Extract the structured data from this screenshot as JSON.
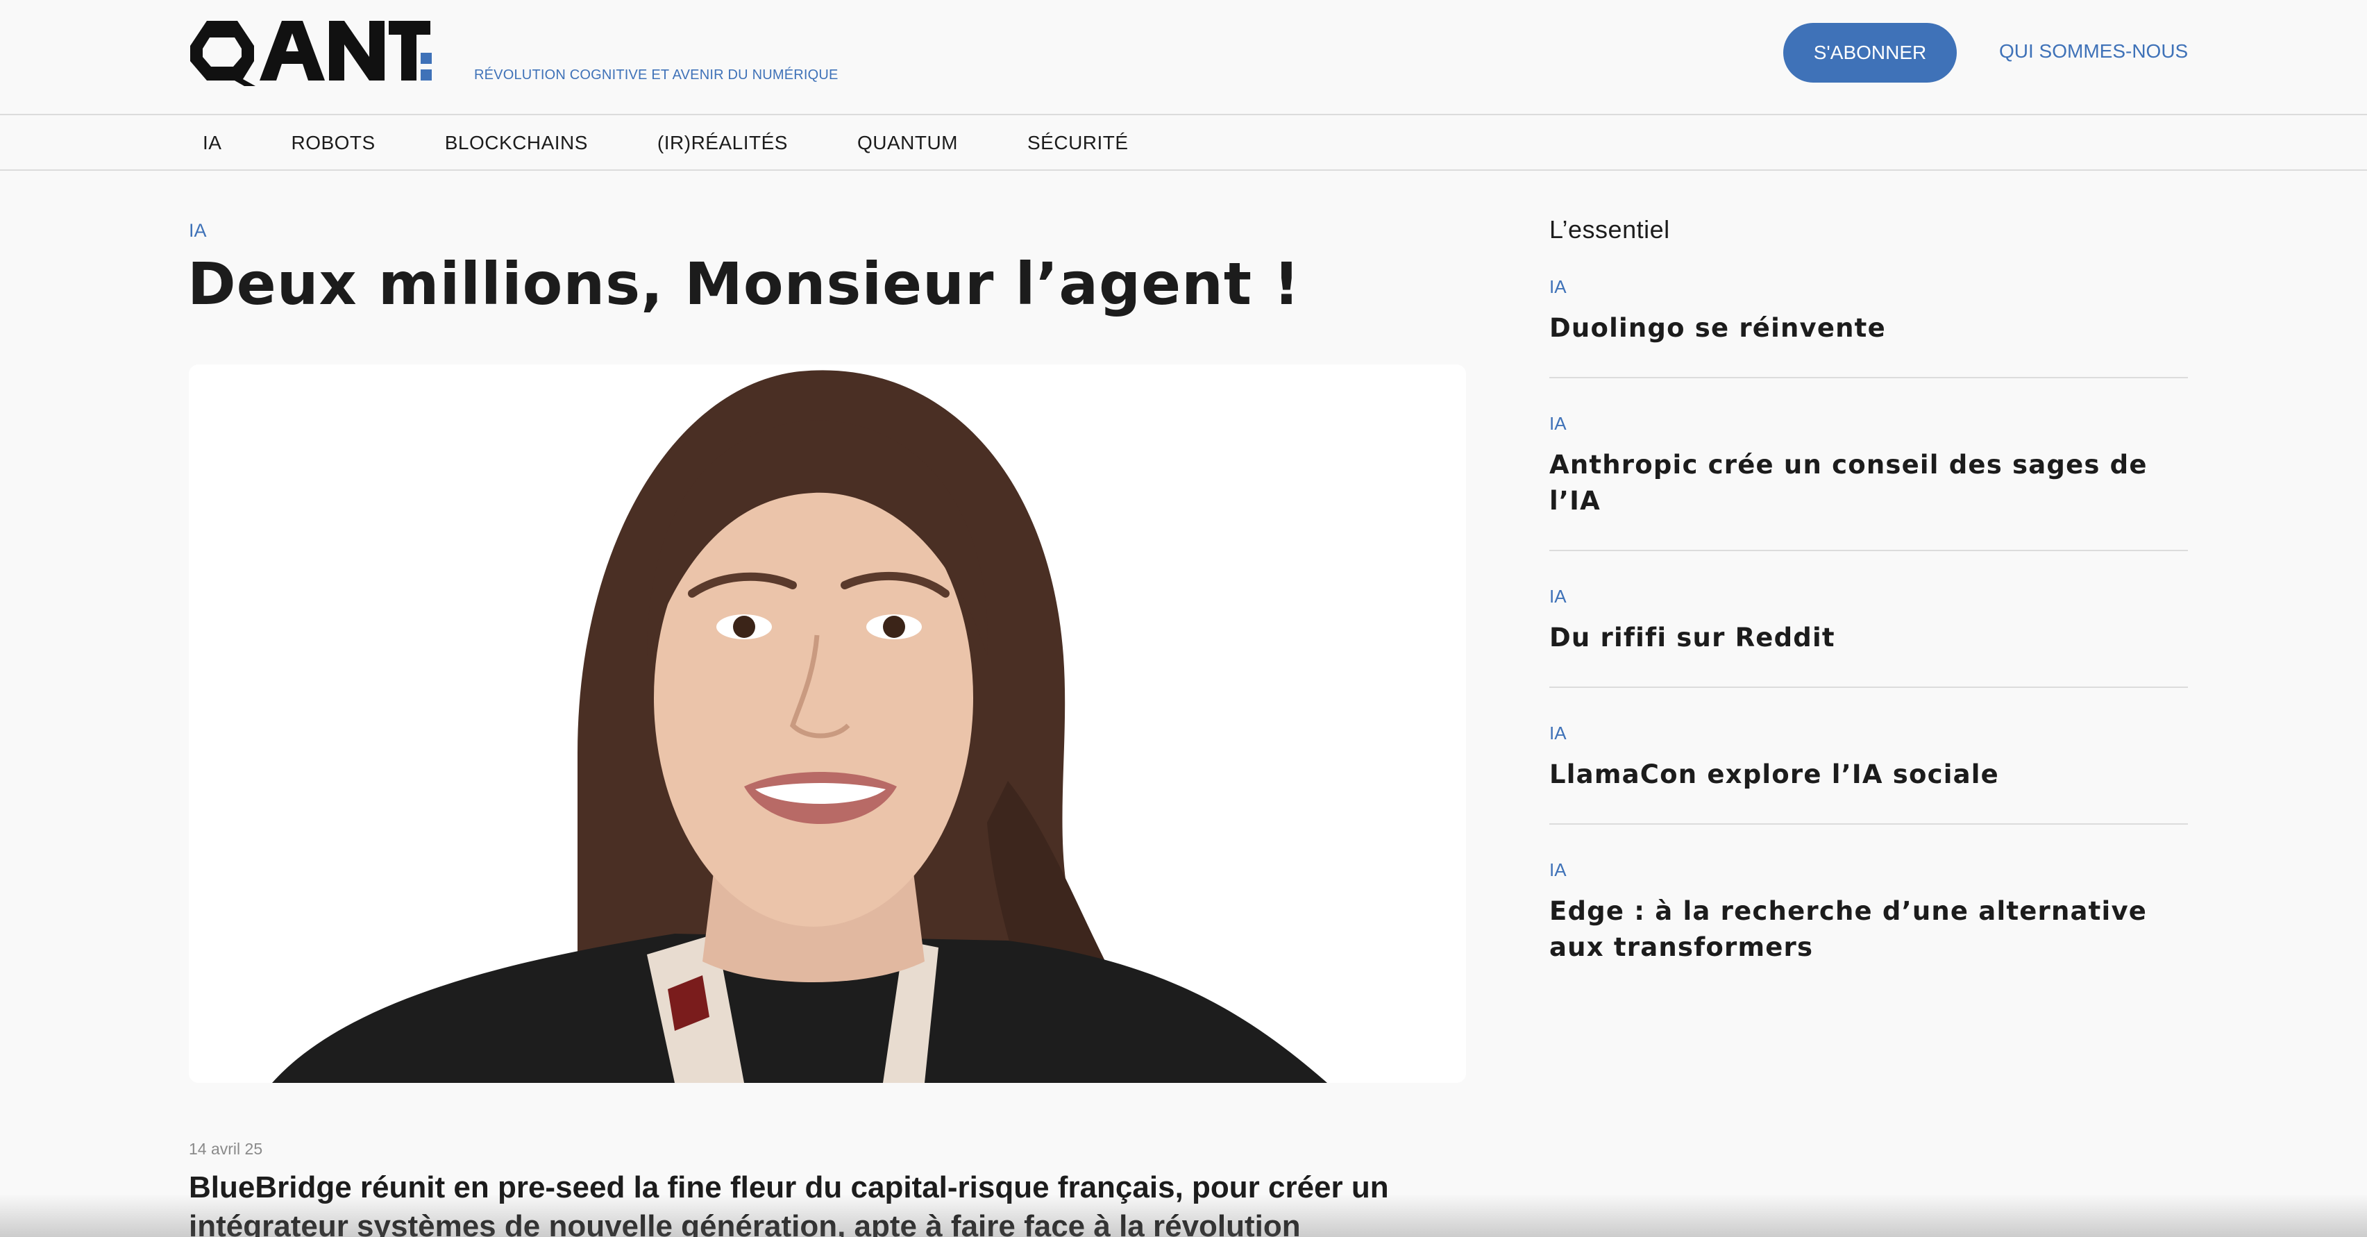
{
  "header": {
    "logo_text": "QANT",
    "tagline": "RÉVOLUTION COGNITIVE ET AVENIR DU NUMÉRIQUE",
    "subscribe_label": "S'ABONNER",
    "about_label": "QUI SOMMES-NOUS"
  },
  "nav": {
    "items": [
      "IA",
      "ROBOTS",
      "BLOCKCHAINS",
      "(IR)RÉALITÉS",
      "QUANTUM",
      "SÉCURITÉ"
    ]
  },
  "article": {
    "category": "IA",
    "title": "Deux millions, Monsieur l’agent !",
    "date": "14 avril 25",
    "lead": "BlueBridge réunit en pre-seed la fine fleur du capital-risque français, pour créer un intégrateur systèmes de nouvelle génération, apte à faire face à la révolution"
  },
  "sidebar": {
    "heading": "L’essentiel",
    "items": [
      {
        "category": "IA",
        "title": "Duolingo se réinvente"
      },
      {
        "category": "IA",
        "title": "Anthropic crée un conseil des sages de l’IA"
      },
      {
        "category": "IA",
        "title": "Du rififi sur Reddit"
      },
      {
        "category": "IA",
        "title": "LlamaCon explore l’IA sociale"
      },
      {
        "category": "IA",
        "title": "Edge : à la recherche d’une alternative aux transformers"
      }
    ]
  },
  "colors": {
    "accent": "#3f72b8",
    "text": "#1c1c1c",
    "background": "#f9f9f9"
  }
}
